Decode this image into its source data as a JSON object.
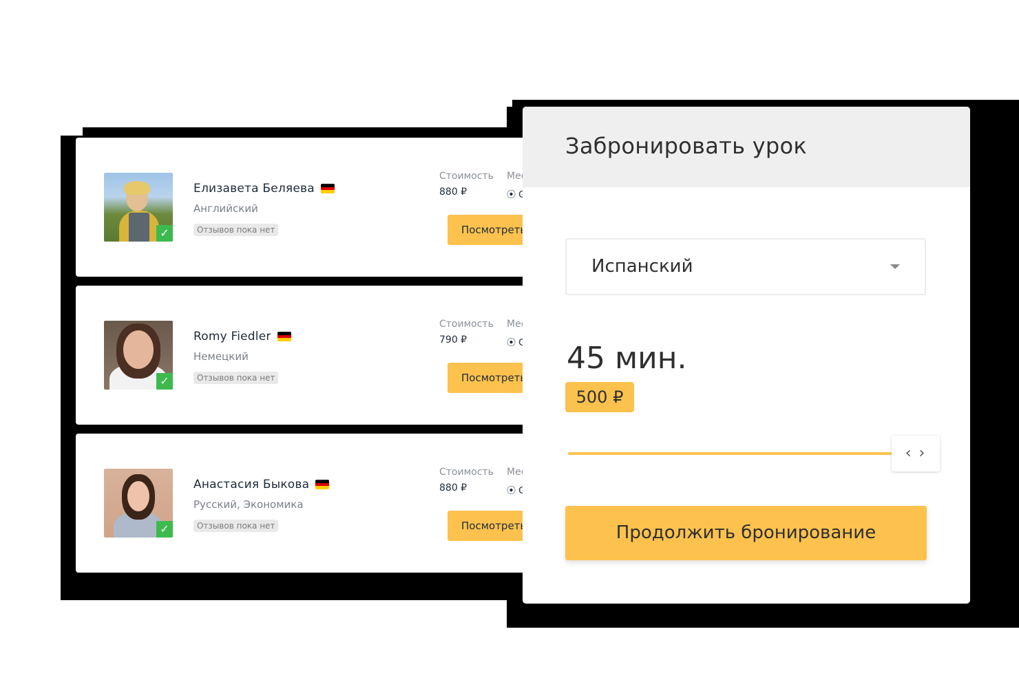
{
  "tutors": [
    {
      "name": "Елизавета Беляева",
      "subject": "Английский",
      "reviews": "Отзывов пока нет",
      "price_label": "Стоимость",
      "price": "880 ₽",
      "place_label": "Мес",
      "place_value": "G",
      "button": "Посмотреть",
      "flag_icon": "germany-flag-icon"
    },
    {
      "name": "Romy Fiedler",
      "subject": "Немецкий",
      "reviews": "Отзывов пока нет",
      "price_label": "Стоимость",
      "price": "790 ₽",
      "place_label": "Мес",
      "place_value": "G",
      "button": "Посмотреть",
      "flag_icon": "germany-flag-icon"
    },
    {
      "name": "Анастасия Быкова",
      "subject": "Русский, Экономика",
      "reviews": "Отзывов пока нет",
      "price_label": "Стоимость",
      "price": "880 ₽",
      "place_label": "Мес",
      "place_value": "G",
      "button": "Посмотреть",
      "flag_icon": "germany-flag-icon"
    }
  ],
  "booking": {
    "title": "Забронировать урок",
    "language": "Испанский",
    "duration": "45 мин.",
    "price": "500 ₽",
    "slider_value": 1.0,
    "slider_handle": "‹ ›",
    "continue_button": "Продолжить бронирование"
  },
  "colors": {
    "accent": "#fcc24d",
    "verified": "#3dba4e",
    "header_bg": "#efefef"
  }
}
